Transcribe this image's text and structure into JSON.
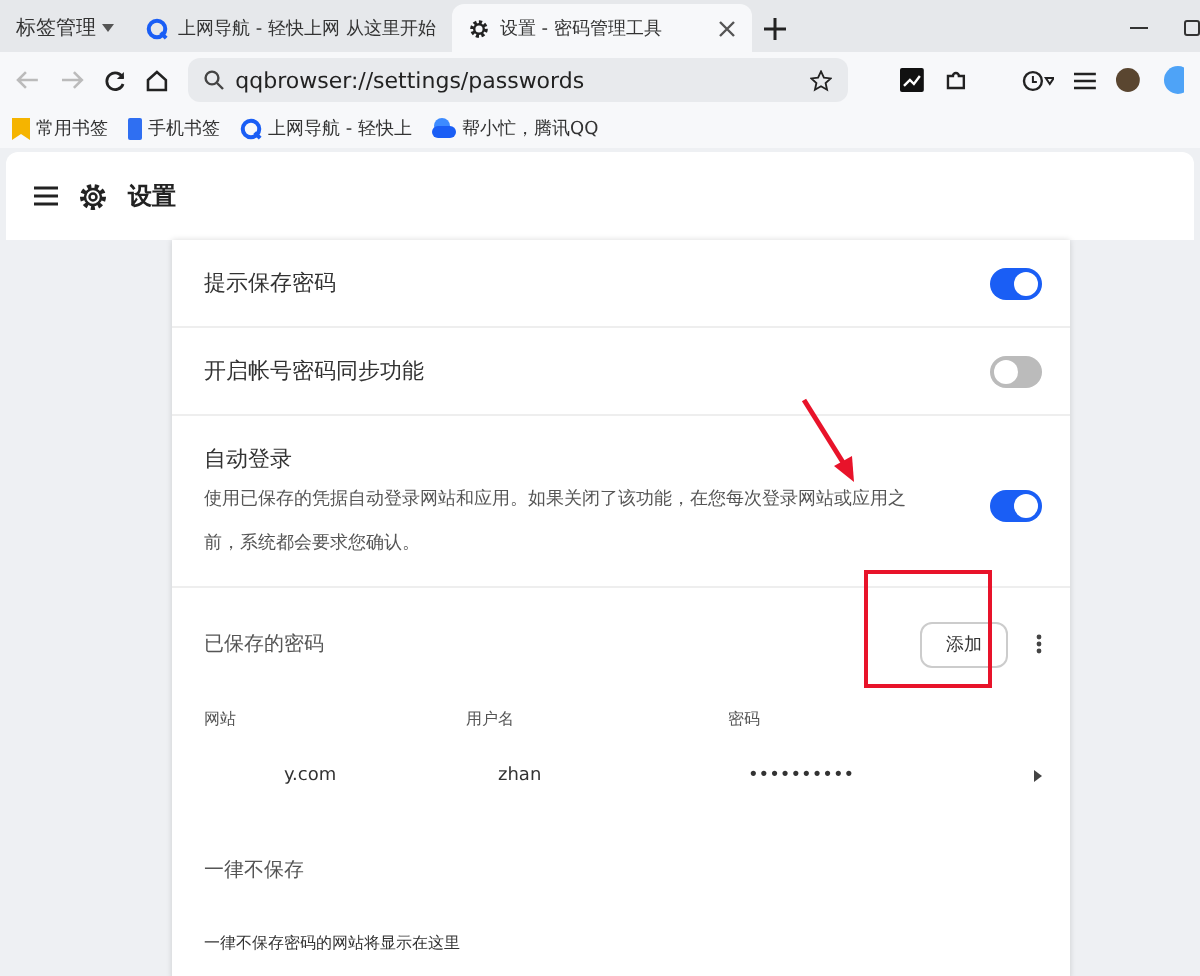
{
  "tab_bar": {
    "group_label": "标签管理",
    "tabs": [
      {
        "title": "上网导航 - 轻快上网 从这里开始",
        "kind": "q",
        "selected": false
      },
      {
        "title": "设置 - 密码管理工具",
        "kind": "gear",
        "selected": true
      }
    ]
  },
  "toolbar": {
    "address": "qqbrowser://settings/passwords"
  },
  "bookmarks": [
    {
      "label": "常用书签",
      "kind": "star"
    },
    {
      "label": "手机书签",
      "kind": "phone"
    },
    {
      "label": "上网导航 - 轻快上",
      "kind": "q"
    },
    {
      "label": "帮小忙，腾讯QQ",
      "kind": "cloud"
    }
  ],
  "page": {
    "title": "设置"
  },
  "settings": [
    {
      "label": "提示保存密码",
      "on": true
    },
    {
      "label": "开启帐号密码同步功能",
      "on": false
    },
    {
      "label": "自动登录",
      "description": "使用已保存的凭据自动登录网站和应用。如果关闭了该功能，在您每次登录网站或应用之前，系统都会要求您确认。",
      "on": true
    }
  ],
  "saved_passwords": {
    "title": "已保存的密码",
    "add_button": "添加",
    "columns": [
      "网站",
      "用户名",
      "密码"
    ],
    "entries": [
      {
        "website": "y.com",
        "username": "zhan",
        "password": "••••••••••"
      }
    ]
  },
  "never_save": {
    "title": "一律不保存",
    "empty_message": "一律不保存密码的网站将显示在这里"
  }
}
